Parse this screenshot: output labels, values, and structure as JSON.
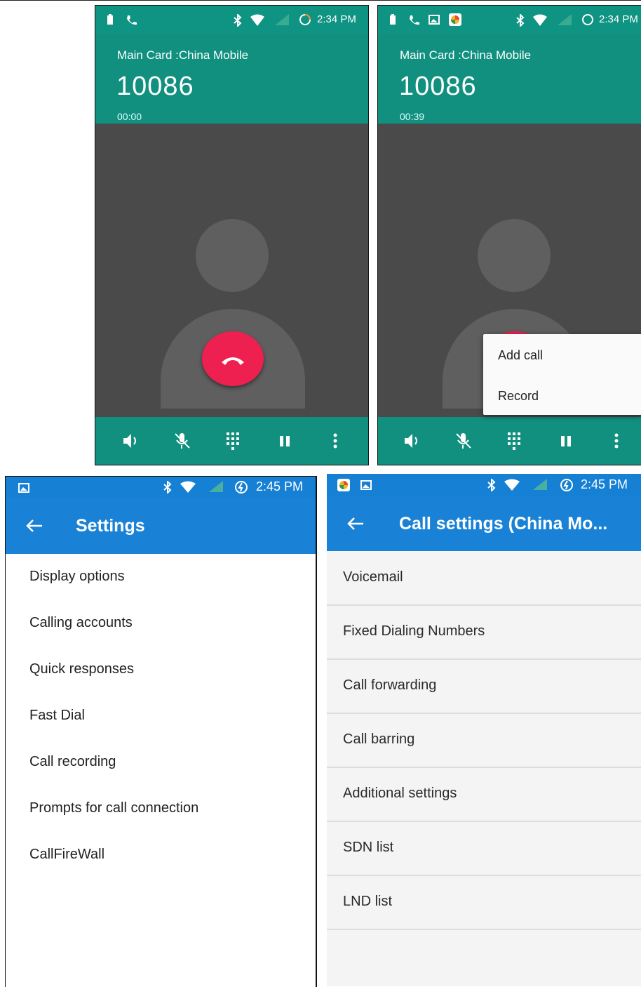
{
  "screens": {
    "incall_1": {
      "status_time": "2:34 PM",
      "carrier": "Main Card :China Mobile",
      "number": "10086",
      "timer": "00:00"
    },
    "incall_2": {
      "status_time": "2:34 PM",
      "carrier": "Main Card :China Mobile",
      "number": "10086",
      "timer": "00:39",
      "menu": [
        "Add call",
        "Record"
      ]
    },
    "settings": {
      "status_time": "2:45 PM",
      "title": "Settings",
      "items": [
        "Display options",
        "Calling accounts",
        "Quick responses",
        "Fast Dial",
        "Call recording",
        "Prompts for call connection",
        "CallFireWall"
      ]
    },
    "call_settings": {
      "status_time": "2:45 PM",
      "title": "Call settings (China Mo...",
      "items": [
        "Voicemail",
        "Fixed Dialing Numbers",
        "Call forwarding",
        "Call barring",
        "Additional settings",
        "SDN list",
        "LND list"
      ]
    }
  },
  "colors": {
    "call_header": "#11907f",
    "call_body": "#4a4a4a",
    "end_call": "#ee2050",
    "settings_bar": "#1a82d6"
  },
  "icons": [
    "battery-icon",
    "phone-icon",
    "image-icon",
    "photos-icon",
    "bluetooth-icon",
    "wifi-icon",
    "signal-icon",
    "data-saver-icon",
    "speaker-icon",
    "mute-icon",
    "dialpad-icon",
    "hold-icon",
    "more-icon",
    "back-arrow-icon",
    "end-call-icon"
  ]
}
